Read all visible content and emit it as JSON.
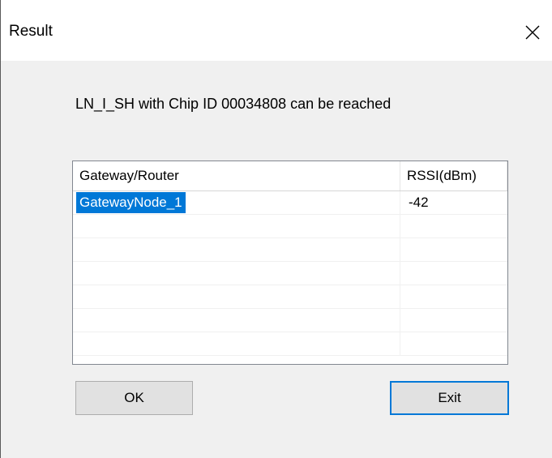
{
  "window": {
    "title": "Result",
    "close_icon": "close-icon"
  },
  "message": "LN_I_SH with Chip ID 00034808 can be reached",
  "table": {
    "columns": [
      "Gateway/Router",
      "RSSI(dBm)"
    ],
    "rows": [
      {
        "gateway": "GatewayNode_1",
        "rssi": "-42",
        "selected": true
      }
    ],
    "empty_rows": 7
  },
  "buttons": {
    "ok_label": "OK",
    "exit_label": "Exit"
  },
  "colors": {
    "selection": "#0078d7",
    "focus_border": "#0078d7"
  }
}
